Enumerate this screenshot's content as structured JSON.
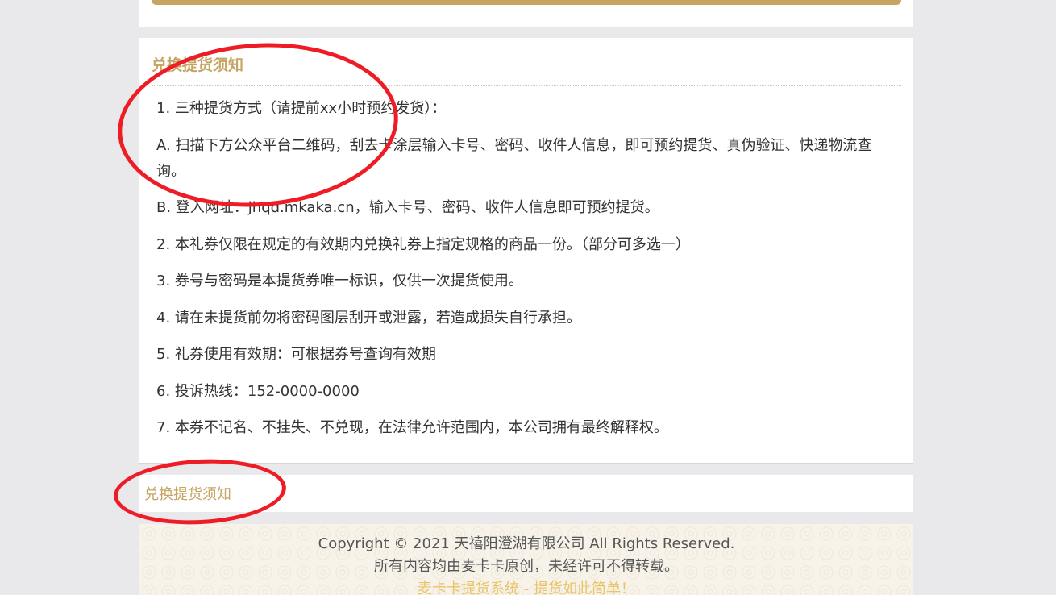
{
  "notice": {
    "title": "兑换提货须知",
    "items": [
      "1. 三种提货方式（请提前xx小时预约发货）：",
      "A. 扫描下方公众平台二维码，刮去卡涂层输入卡号、密码、收件人信息，即可预约提货、真伪验证、快递物流查询。",
      "B. 登入网址：jhqd.mkaka.cn，输入卡号、密码、收件人信息即可预约提货。",
      "2. 本礼券仅限在规定的有效期内兑换礼券上指定规格的商品一份。（部分可多选一）",
      "3. 券号与密码是本提货券唯一标识，仅供一次提货使用。",
      "4. 请在未提货前勿将密码图层刮开或泄露，若造成损失自行承担。",
      "5. 礼券使用有效期：可根据券号查询有效期",
      "6. 投诉热线：152-0000-0000",
      "7. 本券不记名、不挂失、不兑现，在法律允许范围内，本公司拥有最终解释权。"
    ]
  },
  "second_section": {
    "title": "兑换提货须知"
  },
  "footer": {
    "copyright": "Copyright © 2021 天禧阳澄湖有限公司 All Rights Reserved.",
    "notice": "所有内容均由麦卡卡原创，未经许可不得转载。",
    "slogan": "麦卡卡提货系统 - 提货如此简单！"
  },
  "colors": {
    "accent_gold": "#c6a462",
    "annotation_red": "#ee1c25",
    "background": "#e9e9ec"
  }
}
